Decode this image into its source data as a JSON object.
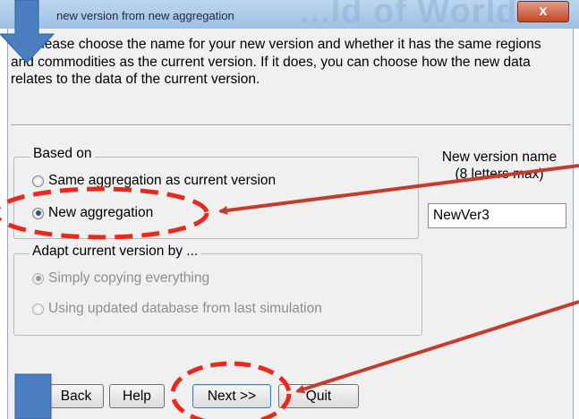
{
  "window": {
    "title": "new version from new aggregation",
    "background_title_fragment": "...ld of World",
    "close_glyph": "x"
  },
  "intro": {
    "text": "Please choose the name for your new version and whether it has the same regions and commodities as the current version. If it does, you can choose how the new data relates to the data of the current version."
  },
  "based_on": {
    "title": "Based on",
    "options": [
      {
        "label": "Same aggregation as current version",
        "selected": false
      },
      {
        "label": "New aggregation",
        "selected": true
      }
    ]
  },
  "adapt": {
    "title": "Adapt current version by ...",
    "enabled": false,
    "options": [
      {
        "label": "Simply copying everything",
        "selected": true
      },
      {
        "label": "Using updated database from last simulation",
        "selected": false
      }
    ]
  },
  "version_name": {
    "label_line1": "New version name",
    "label_line2": "(8 letters max)",
    "value": "NewVer3"
  },
  "buttons": {
    "back": "Back",
    "help": "Help",
    "next": "Next >>",
    "quit": "Quit"
  },
  "annotation_colors": {
    "highlight": "#e8291c",
    "arrow_fill": "#4b7fc1",
    "pointer_arrow": "#c43c2c"
  }
}
